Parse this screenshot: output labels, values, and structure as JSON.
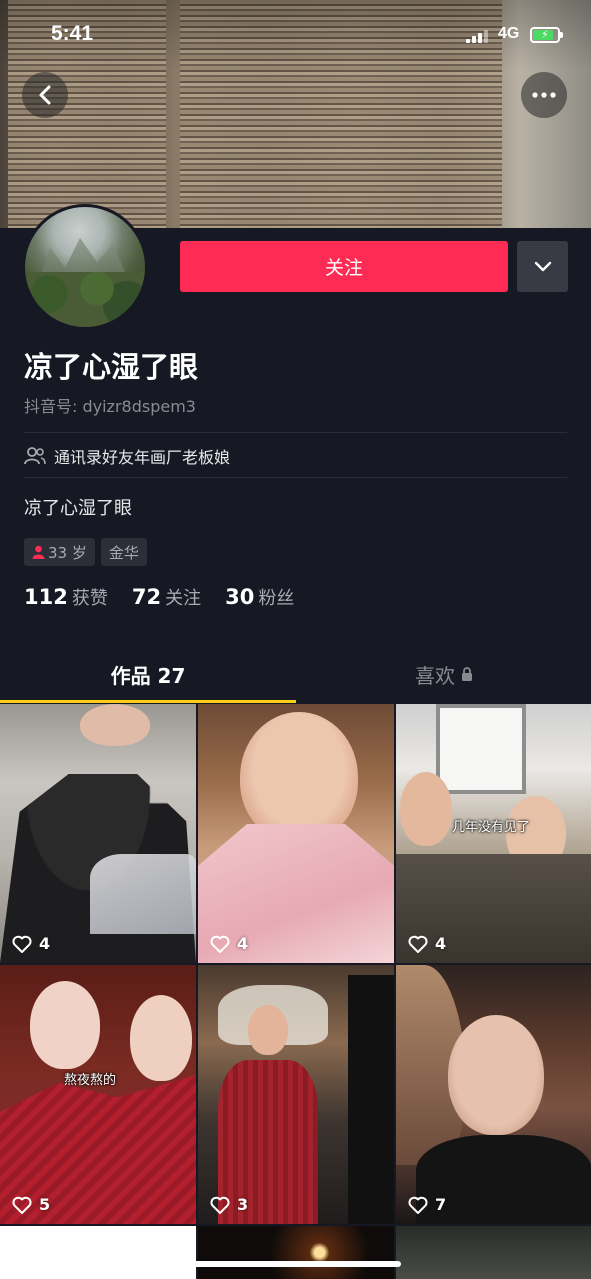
{
  "status_bar": {
    "time": "5:41",
    "network": "4G"
  },
  "profile": {
    "follow_label": "关注",
    "nickname": "凉了心湿了眼",
    "douyin_id": "抖音号: dyizr8dspem3",
    "contact_hint": "通讯录好友年画厂老板娘",
    "bio": "凉了心湿了眼",
    "tags": {
      "age": "33 岁",
      "location": "金华"
    },
    "stats": [
      {
        "number": "112",
        "label": "获赞"
      },
      {
        "number": "72",
        "label": "关注"
      },
      {
        "number": "30",
        "label": "粉丝"
      }
    ]
  },
  "tabs": {
    "works_label": "作品 27",
    "likes_label": "喜欢"
  },
  "videos": [
    {
      "likes": "4",
      "caption": ""
    },
    {
      "likes": "4",
      "caption": ""
    },
    {
      "likes": "4",
      "caption": "几年没有见了"
    },
    {
      "likes": "5",
      "caption": "熬夜熬的"
    },
    {
      "likes": "3",
      "caption": ""
    },
    {
      "likes": "7",
      "caption": ""
    }
  ],
  "colors": {
    "accent": "#fe2c55",
    "background": "#161823",
    "tab_underline": "#face15",
    "female_icon": "#fe2c55"
  },
  "icons": [
    "back-arrow-icon",
    "more-icon",
    "chevron-down-icon",
    "contacts-icon",
    "female-icon",
    "lock-icon",
    "heart-icon"
  ]
}
